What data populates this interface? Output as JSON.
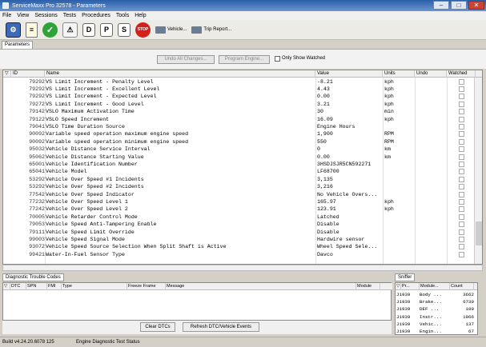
{
  "window": {
    "title": "ServiceMaxx Pro 32578 - Parameters"
  },
  "menu": [
    "File",
    "View",
    "Sessions",
    "Tests",
    "Procedures",
    "Tools",
    "Help"
  ],
  "toolbar": {
    "letters": [
      "D",
      "P",
      "S"
    ],
    "vehicle_label": "Vehicle...",
    "trip_report_label": "Trip Report..."
  },
  "tabs": {
    "parameters": "Parameters"
  },
  "filters": {
    "undo_all": "Undo All Changes...",
    "program_engine": "Program Engine...",
    "only_show_watched": "Only Show Watched"
  },
  "params": {
    "columns": {
      "id": "ID",
      "name": "Name",
      "value": "Value",
      "units": "Units",
      "undo": "Undo",
      "watched": "Watched"
    },
    "rows": [
      {
        "id": "79292",
        "name": "VS Limit Increment - Penalty Level",
        "value": "-8.21",
        "units": "kph"
      },
      {
        "id": "79292",
        "name": "VS Limit Increment - Excellent Level",
        "value": "4.43",
        "units": "kph"
      },
      {
        "id": "79292",
        "name": "VS Limit Increment - Expected Level",
        "value": "0.00",
        "units": "kph"
      },
      {
        "id": "79272",
        "name": "VS Limit Increment - Good Level",
        "value": "3.21",
        "units": "kph"
      },
      {
        "id": "79142",
        "name": "VSLO Maximum Activation Time",
        "value": "30",
        "units": "min"
      },
      {
        "id": "79122",
        "name": "VSLO Speed Increment",
        "value": "16.09",
        "units": "kph"
      },
      {
        "id": "79041",
        "name": "VSLO Time Duration Source",
        "value": "Engine Hours",
        "units": ""
      },
      {
        "id": "90092",
        "name": "Variable speed operation maximum engine speed",
        "value": "1,900",
        "units": "RPM"
      },
      {
        "id": "90092",
        "name": "Variable speed operation minimum engine speed",
        "value": "550",
        "units": "RPM"
      },
      {
        "id": "95032",
        "name": "Vehicle Distance Service Interval",
        "value": "0",
        "units": "km"
      },
      {
        "id": "95062",
        "name": "Vehicle Distance Starting Value",
        "value": "0.00",
        "units": "km"
      },
      {
        "id": "65001",
        "name": "Vehicle Identification Number",
        "value": "3HSDJSJR5CN592271",
        "units": ""
      },
      {
        "id": "65041",
        "name": "Vehicle Model",
        "value": "LF68700",
        "units": ""
      },
      {
        "id": "53292",
        "name": "Vehicle Over Speed #1 Incidents",
        "value": "3,135",
        "units": ""
      },
      {
        "id": "53292",
        "name": "Vehicle Over Speed #2 Incidents",
        "value": "3,216",
        "units": ""
      },
      {
        "id": "77542",
        "name": "Vehicle Over Speed Indicator",
        "value": "No Vehicle Overs...",
        "units": ""
      },
      {
        "id": "77232",
        "name": "Vehicle Over Speed Level 1",
        "value": "165.97",
        "units": "kph"
      },
      {
        "id": "77242",
        "name": "Vehicle Over Speed Level 2",
        "value": "123.91",
        "units": "kph"
      },
      {
        "id": "70005",
        "name": "Vehicle Retarder Control Mode",
        "value": "Latched",
        "units": ""
      },
      {
        "id": "79053",
        "name": "Vehicle Speed Anti-Tampering Enable",
        "value": "Disable",
        "units": ""
      },
      {
        "id": "79111",
        "name": "Vehicle Speed Limit Override",
        "value": "Disable",
        "units": ""
      },
      {
        "id": "99003",
        "name": "Vehicle Speed Signal Mode",
        "value": "Hardwire sensor",
        "units": ""
      },
      {
        "id": "93072",
        "name": "Vehicle Speed Source Selection When Split Shaft is Active",
        "value": "Wheel Speed Sele...",
        "units": ""
      },
      {
        "id": "99421",
        "name": "Water-In-Fuel Sensor Type",
        "value": "Davco",
        "units": ""
      }
    ]
  },
  "dtc": {
    "tab_label": "Diagnostic Trouble Codes",
    "columns": {
      "dtc": "DTC",
      "spn": "SPN",
      "fmi": "FMI",
      "type": "Type",
      "freeze": "Freeze Frame",
      "message": "Message",
      "module": "Module"
    },
    "clear_btn": "Clear DTCs",
    "refresh_btn": "Refresh DTC/Vehicle Events"
  },
  "sniffer": {
    "tab_label": "Sniffer",
    "columns": {
      "proto": "Pr...",
      "module": "Module...",
      "count": "Count"
    },
    "rows": [
      {
        "proto": "J1939",
        "module": "Body ...",
        "count": "3662"
      },
      {
        "proto": "J1939",
        "module": "Brake...",
        "count": "6739"
      },
      {
        "proto": "J1939",
        "module": "DEF ...",
        "count": "109"
      },
      {
        "proto": "J1939",
        "module": "Instr...",
        "count": "1966"
      },
      {
        "proto": "J1939",
        "module": "Vehic...",
        "count": "137"
      },
      {
        "proto": "J1939",
        "module": "Engin...",
        "count": "67"
      }
    ]
  },
  "status": {
    "build": "Build v4.24.20.6078 125",
    "diag": "Engine Diagnostic Test Status"
  }
}
